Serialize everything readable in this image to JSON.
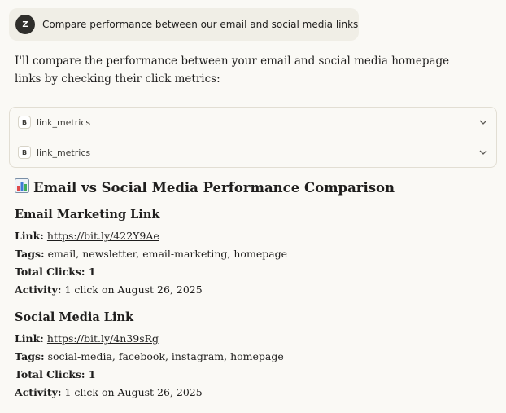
{
  "user_message": {
    "avatar_letter": "Z",
    "text": "Compare performance between our email and social media links"
  },
  "assistant": {
    "intro": "I'll compare the performance between your email and social media homepage links by checking their click metrics:",
    "tool_calls": [
      {
        "badge": "B",
        "name": "link_metrics"
      },
      {
        "badge": "B",
        "name": "link_metrics"
      }
    ],
    "report": {
      "heading_icon": "bar-chart-icon",
      "heading": "Email vs Social Media Performance Comparison",
      "sections": [
        {
          "title": "Email Marketing Link",
          "link_label": "Link:",
          "link": "https://bit.ly/422Y9Ae",
          "tags_label": "Tags:",
          "tags": "email, newsletter, email-marketing, homepage",
          "clicks_label": "Total Clicks: 1",
          "activity_label": "Activity:",
          "activity": "1 click on August 26, 2025"
        },
        {
          "title": "Social Media Link",
          "link_label": "Link:",
          "link": "https://bit.ly/4n39sRg",
          "tags_label": "Tags:",
          "tags": "social-media, facebook, instagram, homepage",
          "clicks_label": "Total Clicks: 1",
          "activity_label": "Activity:",
          "activity": "1 click on August 26, 2025"
        }
      ]
    }
  }
}
